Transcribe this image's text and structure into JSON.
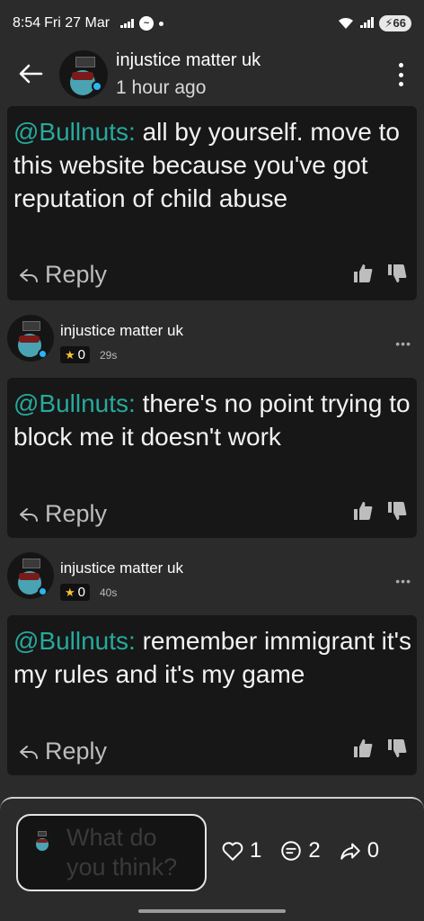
{
  "status_bar": {
    "time": "8:54",
    "date": "Fri 27 Mar",
    "battery": "66"
  },
  "header": {
    "title": "injustice matter uk",
    "subtitle": "1 hour ago"
  },
  "comments": [
    {
      "mention": "@Bullnuts:",
      "text": " all by yourself. move to this website because you've got reputation of child abuse",
      "reply_label": "Reply"
    },
    {
      "author": "injustice matter uk",
      "reputation": "0",
      "time": "29s",
      "mention": "@Bullnuts:",
      "text": " there's no point trying to block me it doesn't work",
      "reply_label": "Reply",
      "more": "•••"
    },
    {
      "author": "injustice matter uk",
      "reputation": "0",
      "time": "40s",
      "mention": "@Bullnuts:",
      "text": " remember immigrant it's my rules and it's my game",
      "reply_label": "Reply",
      "more": "•••"
    }
  ],
  "composer": {
    "placeholder": "What do you think?",
    "likes": "1",
    "comments": "2",
    "shares": "0"
  },
  "colors": {
    "mention": "#27a99d",
    "background": "#2b2b2b",
    "card": "#171717"
  }
}
